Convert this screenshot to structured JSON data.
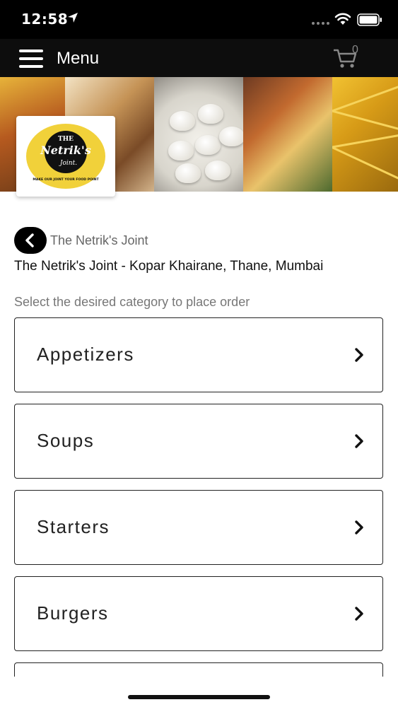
{
  "status_bar": {
    "time": "12:58"
  },
  "nav": {
    "title": "Menu",
    "cart_count": "0"
  },
  "logo": {
    "text_top": "THE",
    "text_main": "Netrik's",
    "text_bottom": "Joint.",
    "tagline": "MAKE OUR JOINT YOUR FOOD POINT"
  },
  "restaurant": {
    "short_name": "The Netrik's Joint",
    "full_name": "The Netrik's Joint - Kopar Khairane, Thane, Mumbai",
    "hint": "Select the desired category to place order"
  },
  "categories": [
    {
      "label": "Appetizers"
    },
    {
      "label": "Soups"
    },
    {
      "label": "Starters"
    },
    {
      "label": "Burgers"
    },
    {
      "label": ""
    }
  ],
  "colors": {
    "logo_yellow": "#f1d13a",
    "nav_bg": "#0d0d0d",
    "status_bg": "#000000"
  }
}
